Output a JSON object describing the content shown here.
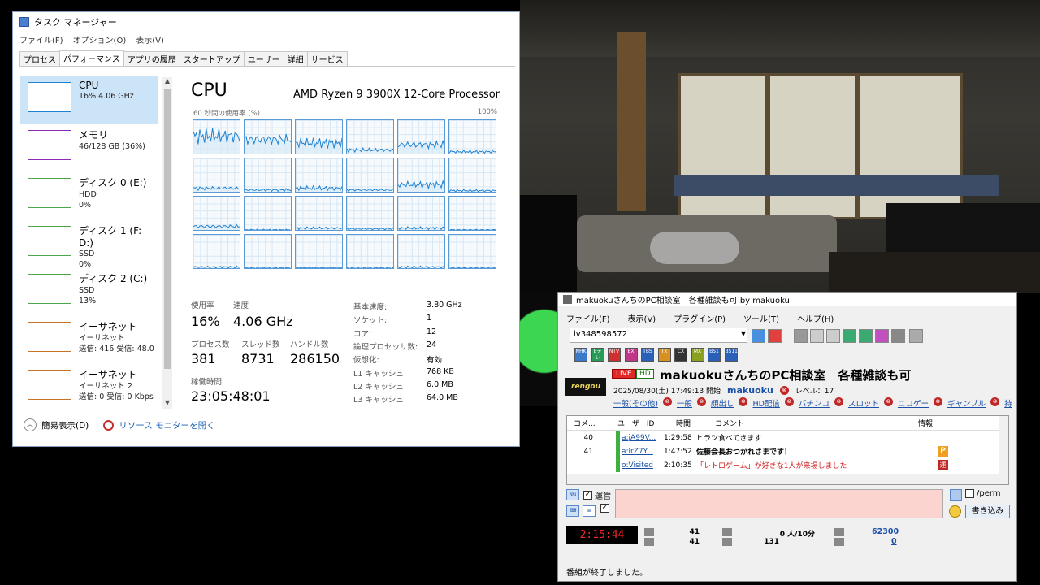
{
  "task_manager": {
    "title": "タスク マネージャー",
    "menu": [
      "ファイル(F)",
      "オプション(O)",
      "表示(V)"
    ],
    "tabs": [
      "プロセス",
      "パフォーマンス",
      "アプリの履歴",
      "スタートアップ",
      "ユーザー",
      "詳細",
      "サービス"
    ],
    "active_tab": "パフォーマンス",
    "sidebar": [
      {
        "name": "CPU",
        "sub1": "16% 4.06 GHz",
        "sub2": "",
        "sub3": "",
        "color": "#1e82d2"
      },
      {
        "name": "メモリ",
        "sub1": "46/128 GB (36%)",
        "sub2": "",
        "sub3": "",
        "color": "#8b2bb3"
      },
      {
        "name": "ディスク 0 (E:)",
        "sub1": "HDD",
        "sub2": "0%",
        "sub3": "",
        "color": "#4ca64c"
      },
      {
        "name": "ディスク 1 (F: D:)",
        "sub1": "SSD",
        "sub2": "0%",
        "sub3": "",
        "color": "#4ca64c"
      },
      {
        "name": "ディスク 2 (C:)",
        "sub1": "SSD",
        "sub2": "13%",
        "sub3": "",
        "color": "#4ca64c"
      },
      {
        "name": "イーサネット",
        "sub1": "イーサネット",
        "sub2": "送信: 416 受信: 48.0",
        "sub3": "",
        "color": "#c87128"
      },
      {
        "name": "イーサネット",
        "sub1": "イーサネット 2",
        "sub2": "送信: 0 受信: 0 Kbps",
        "sub3": "",
        "color": "#c87128"
      }
    ],
    "cpu": {
      "title": "CPU",
      "model": "AMD Ryzen 9 3900X 12-Core Processor",
      "graph_caption": "60 秒間の使用率 (%)",
      "graph_max": "100%",
      "stats": {
        "usage_label": "使用率",
        "usage": "16%",
        "speed_label": "速度",
        "speed": "4.06 GHz",
        "processes_label": "プロセス数",
        "processes": "381",
        "threads_label": "スレッド数",
        "threads": "8731",
        "handles_label": "ハンドル数",
        "handles": "286150",
        "uptime_label": "稼働時間",
        "uptime": "23:05:48:01"
      },
      "info": [
        {
          "label": "基本速度:",
          "value": "3.80 GHz"
        },
        {
          "label": "ソケット:",
          "value": "1"
        },
        {
          "label": "コア:",
          "value": "12"
        },
        {
          "label": "論理プロセッサ数:",
          "value": "24"
        },
        {
          "label": "仮想化:",
          "value": "有効"
        },
        {
          "label": "L1 キャッシュ:",
          "value": "768 KB"
        },
        {
          "label": "L2 キャッシュ:",
          "value": "6.0 MB"
        },
        {
          "label": "L3 キャッシュ:",
          "value": "64.0 MB"
        }
      ],
      "core_levels": [
        0.55,
        0.45,
        0.35,
        0.15,
        0.3,
        0.1,
        0.15,
        0.1,
        0.15,
        0.1,
        0.25,
        0.08,
        0.15,
        0.05,
        0.1,
        0.08,
        0.1,
        0.05,
        0.08,
        0.05,
        0.06,
        0.05,
        0.08,
        0.05
      ]
    },
    "footer": {
      "less_details": "簡易表示(D)",
      "resource_monitor": "リソース モニターを開く"
    }
  },
  "ncv": {
    "title": "makuokuさんちのPC相談室　各種雑談も可 by makuoku",
    "menu": [
      "ファイル(F)",
      "表示(V)",
      "プラグイン(P)",
      "ツール(T)",
      "ヘルプ(H)"
    ],
    "live_id": "lv348598572",
    "channels": [
      "NHK",
      "EテレNHK",
      "NTV",
      "EX",
      "TBS",
      "TX",
      "CX",
      "MX",
      "BS1",
      "BS11"
    ],
    "channel_colors": [
      "#3a78c8",
      "#2a9a58",
      "#d03030",
      "#c03888",
      "#2a60b8",
      "#d89020",
      "#333333",
      "#8aa020",
      "#2a60b8",
      "#2a60b8"
    ],
    "logo": "rengou",
    "live_badge": "LIVE",
    "hd_badge": "HD",
    "broadcast_title": "makuokuさんちのPC相談室　各種雑談も可",
    "start_info": "2025/08/30(土) 17:49:13 開始",
    "owner": "makuoku",
    "level": "レベル：17",
    "tags": [
      "一般(その他)",
      "一般",
      "顔出し",
      "HD配信",
      "パチンコ",
      "スロット",
      "ニコゲー",
      "ギャンブル",
      "持"
    ],
    "columns": [
      "コメ...",
      "ユーザーID",
      "時間",
      "コメント",
      "情報"
    ],
    "comments": [
      {
        "no": "40",
        "uid": "a:jA99V...",
        "time": "1:29:58",
        "text": "ヒラツ食べてきます",
        "info": "",
        "bold": false,
        "color": "#000000"
      },
      {
        "no": "41",
        "uid": "a:lrZ7Y...",
        "time": "1:47:52",
        "text": "佐藤会長おつかれさまです！",
        "info": "P",
        "bold": true,
        "color": "#000000"
      },
      {
        "no": "",
        "uid": "o:Visited",
        "time": "2:10:35",
        "text": "「レトロゲーム」が好きな1人が来場しました",
        "info": "運",
        "bold": false,
        "color": "#d02020"
      }
    ],
    "operator_label": "運営",
    "perm_label": "/perm",
    "write_button": "書き込み",
    "timer": "2:15:44",
    "stat_a1": "41",
    "stat_a2": "41",
    "stat_b1": "0 人/10分",
    "stat_b2": "131",
    "stat_c1": "62300",
    "stat_c2": "0",
    "status": "番組が終了しました。"
  }
}
